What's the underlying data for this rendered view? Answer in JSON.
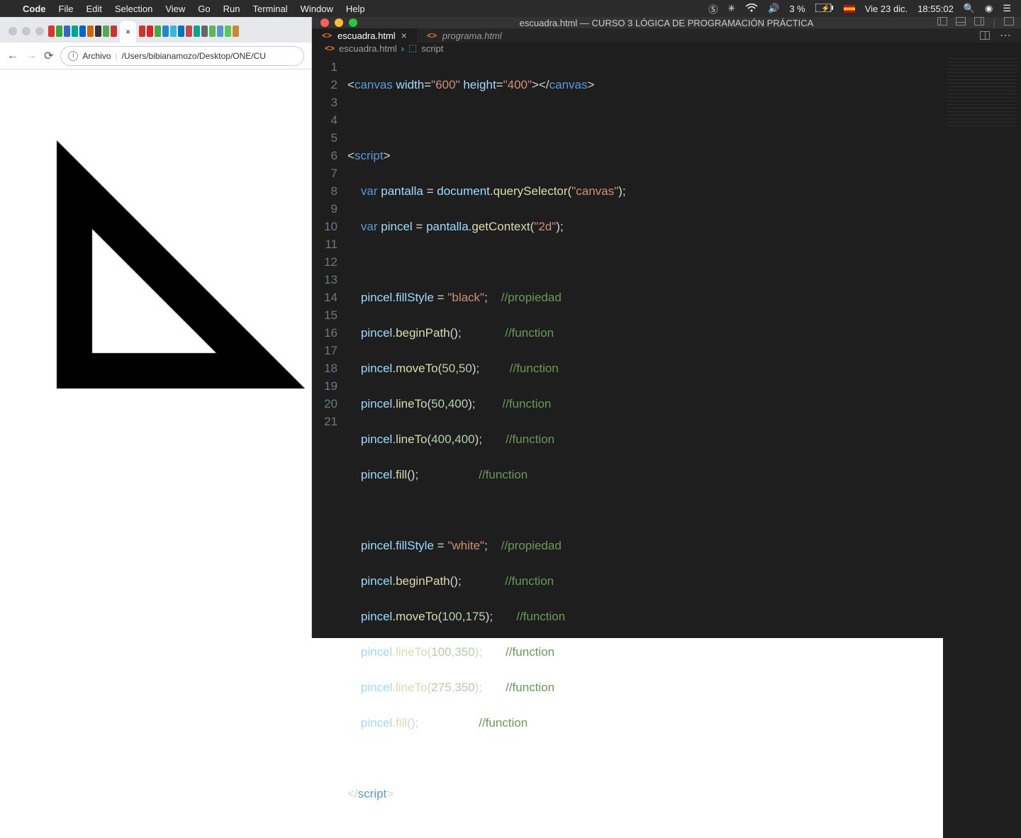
{
  "menubar": {
    "app": "Code",
    "items": [
      "File",
      "Edit",
      "Selection",
      "View",
      "Go",
      "Run",
      "Terminal",
      "Window",
      "Help"
    ],
    "battery": "3 %",
    "date": "Vie 23 dic.",
    "time": "18:55:02"
  },
  "chrome": {
    "active_tab_close": "×",
    "addr_label": "Archivo",
    "addr_path": "/Users/bibianamozo/Desktop/ONE/CU"
  },
  "vscode": {
    "title": "escuadra.html — CURSO 3 LÓGICA DE PROGRAMACIÓN PRÁCTICA",
    "tabs": {
      "active": "escuadra.html",
      "active_close": "×",
      "inactive": "programa.html"
    },
    "breadcrumb": {
      "file": "escuadra.html",
      "sep": "›",
      "symbol": "script"
    },
    "line_numbers": [
      "1",
      "2",
      "3",
      "4",
      "5",
      "6",
      "7",
      "8",
      "9",
      "10",
      "11",
      "12",
      "13",
      "14",
      "15",
      "16",
      "17",
      "18",
      "19",
      "20",
      "21"
    ],
    "code": {
      "l1": {
        "t1": "canvas",
        "a1": "width",
        "v1": "\"600\"",
        "a2": "height",
        "v2": "\"400\"",
        "t2": "canvas"
      },
      "l3": {
        "t": "script"
      },
      "l4": {
        "kw": "var",
        "v": "pantalla",
        "o": "document",
        "f": "querySelector",
        "s": "\"canvas\""
      },
      "l5": {
        "kw": "var",
        "v": "pincel",
        "o": "pantalla",
        "f": "getContext",
        "s": "\"2d\""
      },
      "l7": {
        "o": "pincel",
        "p": "fillStyle",
        "s": "\"black\"",
        "c": "//propiedad"
      },
      "l8": {
        "o": "pincel",
        "f": "beginPath",
        "c": "//function"
      },
      "l9": {
        "o": "pincel",
        "f": "moveTo",
        "n1": "50",
        "n2": "50",
        "c": "//function"
      },
      "l10": {
        "o": "pincel",
        "f": "lineTo",
        "n1": "50",
        "n2": "400",
        "c": "//function"
      },
      "l11": {
        "o": "pincel",
        "f": "lineTo",
        "n1": "400",
        "n2": "400",
        "c": "//function"
      },
      "l12": {
        "o": "pincel",
        "f": "fill",
        "c": "//function"
      },
      "l14": {
        "o": "pincel",
        "p": "fillStyle",
        "s": "\"white\"",
        "c": "//propiedad"
      },
      "l15": {
        "o": "pincel",
        "f": "beginPath",
        "c": "//function"
      },
      "l16": {
        "o": "pincel",
        "f": "moveTo",
        "n1": "100",
        "n2": "175",
        "c": "//function"
      },
      "l17": {
        "o": "pincel",
        "f": "lineTo",
        "n1": "100",
        "n2": "350",
        "c": "//function"
      },
      "l18": {
        "o": "pincel",
        "f": "lineTo",
        "n1": "275",
        "n2": "350",
        "c": "//function"
      },
      "l19": {
        "o": "pincel",
        "f": "fill",
        "c": "//function"
      },
      "l21": {
        "t": "script"
      }
    }
  }
}
